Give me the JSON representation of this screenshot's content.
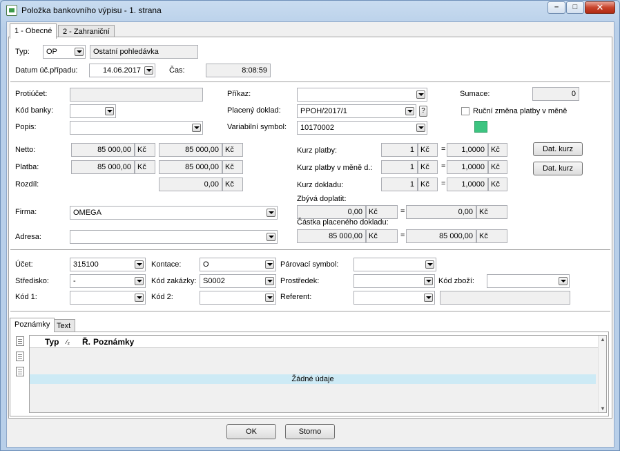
{
  "window": {
    "title": "Položka bankovního výpisu - 1. strana"
  },
  "tabs": [
    {
      "label": "1 - Obecné"
    },
    {
      "label": "2 - Zahraniční"
    }
  ],
  "header": {
    "typ_label": "Typ:",
    "typ_code": "OP",
    "typ_name": "Ostatní pohledávka",
    "datum_label": "Datum úč.případu:",
    "datum_value": "14.06.2017",
    "cas_label": "Čas:",
    "cas_value": "8:08:59"
  },
  "left": {
    "protiucet_label": "Protiúčet:",
    "protiucet_value": "",
    "kod_banky_label": "Kód banky:",
    "kod_banky_value": "",
    "popis_label": "Popis:",
    "popis_value": "",
    "netto_label": "Netto:",
    "netto_value1": "85 000,00",
    "netto_value2": "85 000,00",
    "platba_label": "Platba:",
    "platba_value1": "85 000,00",
    "platba_value2": "85 000,00",
    "rozdil_label": "Rozdíl:",
    "rozdil_value": "0,00",
    "currency": "Kč",
    "firma_label": "Firma:",
    "firma_value": "OMEGA",
    "adresa_label": "Adresa:",
    "adresa_value": ""
  },
  "middle": {
    "prikaz_label": "Příkaz:",
    "prikaz_value": "",
    "placeny_label": "Placený doklad:",
    "placeny_value": "PPOH/2017/1",
    "placeny_help": "?",
    "varsym_label": "Variabilní symbol:",
    "varsym_value": "10170002",
    "kurz_platby_label": "Kurz platby:",
    "kurz_platby_mena_label": "Kurz platby v měně d.:",
    "kurz_dokladu_label": "Kurz dokladu:",
    "kurz_left": "1",
    "kurz_right": "1,0000",
    "eq": "=",
    "zbyva_label": "Zbývá doplatit:",
    "zbyva_value1": "0,00",
    "zbyva_value2": "0,00",
    "castka_label": "Částka placeného dokladu:",
    "castka_value1": "85 000,00",
    "castka_value2": "85 000,00"
  },
  "right": {
    "sumace_label": "Sumace:",
    "sumace_value": "0",
    "rucni_label": "Ruční změna platby v měně",
    "swatch_color": "#3cc480",
    "dat_kurz_label": "Dat. kurz"
  },
  "accounting": {
    "ucet_label": "Účet:",
    "ucet_value": "315100",
    "stredisko_label": "Středisko:",
    "stredisko_value": "-",
    "kod1_label": "Kód 1:",
    "kod1_value": "",
    "kontace_label": "Kontace:",
    "kontace_value": "O",
    "zakazka_label": "Kód zakázky:",
    "zakazka_value": "S0002",
    "kod2_label": "Kód 2:",
    "kod2_value": "",
    "parovaci_label": "Párovací symbol:",
    "parovaci_value": "",
    "prostredek_label": "Prostředek:",
    "prostredek_value": "",
    "referent_label": "Referent:",
    "referent_value": "",
    "kodzbozi_label": "Kód zboží:",
    "kodzbozi_value": "",
    "extra_value": ""
  },
  "subtabs": [
    {
      "label": "Poznámky"
    },
    {
      "label": "Text"
    }
  ],
  "grid": {
    "columns": [
      "Typ",
      "⁄₂",
      "Ř.",
      "Poznámky"
    ],
    "empty_text": "Žádné údaje"
  },
  "footer": {
    "ok_label": "OK",
    "storno_label": "Storno"
  }
}
